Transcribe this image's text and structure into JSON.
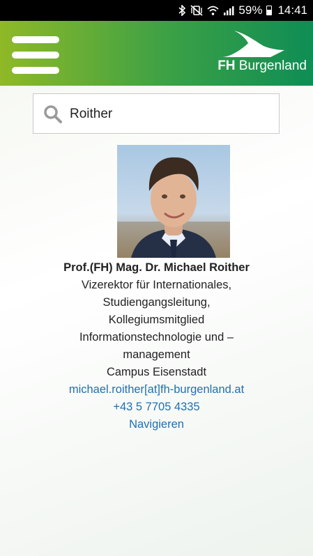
{
  "status_bar": {
    "bluetooth_icon": "bluetooth-icon",
    "mute_icon": "vibrate-mute-icon",
    "wifi_icon": "wifi-icon",
    "signal_icon": "signal-icon",
    "battery_percent": "59%",
    "time": "14:41"
  },
  "header": {
    "menu_icon": "hamburger-menu-icon",
    "logo_bold": "FH",
    "logo_rest": "Burgenland",
    "colors": {
      "start": "#8fb927",
      "end": "#0f8d55"
    }
  },
  "search": {
    "value": "Roither",
    "icon": "search-icon"
  },
  "person": {
    "photo": "portrait-photo",
    "name": "Prof.(FH) Mag. Dr. Michael Roither",
    "role_line1": "Vizerektor für Internationales,",
    "role_line2": "Studiengangsleitung,",
    "role_line3": "Kollegiumsmitglied",
    "dept_line1": "Informationstechnologie und –",
    "dept_line2": "management",
    "campus": "Campus Eisenstadt",
    "email": "michael.roither[at]fh-burgenland.at",
    "phone": "+43 5 7705 4335",
    "navigate": "Navigieren",
    "link_color": "#1f6fb2"
  }
}
